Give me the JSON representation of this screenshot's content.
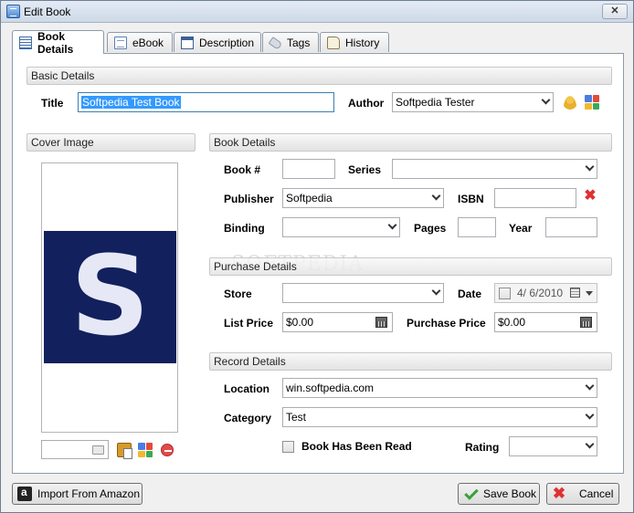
{
  "window": {
    "title": "Edit Book",
    "close_glyph": "✕"
  },
  "tabs": [
    {
      "label": "Book Details",
      "icon": "grid-icon",
      "active": true
    },
    {
      "label": "eBook",
      "icon": "document-icon"
    },
    {
      "label": "Description",
      "icon": "description-icon"
    },
    {
      "label": "Tags",
      "icon": "tag-icon"
    },
    {
      "label": "History",
      "icon": "scroll-icon"
    }
  ],
  "basic_details": {
    "heading": "Basic Details",
    "title_label": "Title",
    "title_value": "Softpedia Test Book",
    "author_label": "Author",
    "author_value": "Softpedia Tester"
  },
  "cover": {
    "heading": "Cover Image",
    "image_letter": "S",
    "file_value": ""
  },
  "book_details": {
    "heading": "Book Details",
    "book_no_label": "Book #",
    "book_no_value": "",
    "series_label": "Series",
    "series_value": "",
    "publisher_label": "Publisher",
    "publisher_value": "Softpedia",
    "isbn_label": "ISBN",
    "isbn_value": "",
    "binding_label": "Binding",
    "binding_value": "",
    "pages_label": "Pages",
    "pages_value": "",
    "year_label": "Year",
    "year_value": ""
  },
  "purchase_details": {
    "heading": "Purchase Details",
    "store_label": "Store",
    "store_value": "",
    "date_label": "Date",
    "date_value": "4/ 6/2010",
    "list_price_label": "List Price",
    "list_price_value": "$0.00",
    "purchase_price_label": "Purchase Price",
    "purchase_price_value": "$0.00"
  },
  "record_details": {
    "heading": "Record Details",
    "location_label": "Location",
    "location_value": "win.softpedia.com",
    "category_label": "Category",
    "category_value": "Test",
    "read_label": "Book Has Been Read",
    "read_checked": false,
    "rating_label": "Rating",
    "rating_value": ""
  },
  "footer": {
    "import_label": "Import From Amazon",
    "save_label": "Save Book",
    "cancel_label": "Cancel"
  },
  "watermark": "SOFTPEDIA",
  "colors": {
    "selection": "#3399ff",
    "cover_bg": "#13205e",
    "delete_red": "#e03030",
    "save_green": "#3aa03a"
  }
}
